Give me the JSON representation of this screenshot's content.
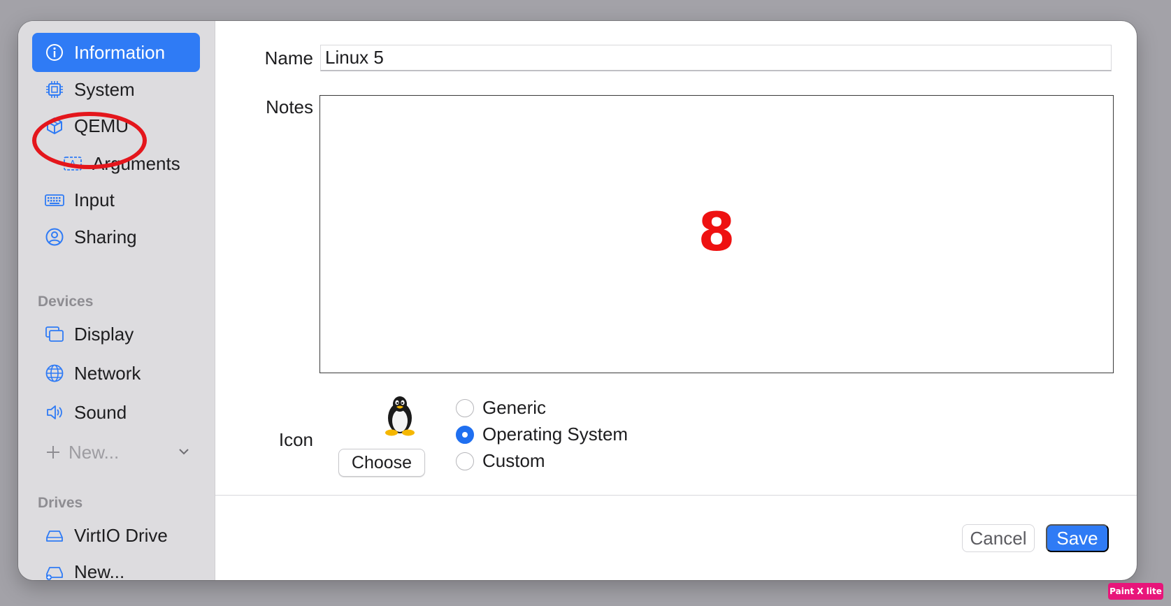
{
  "sidebar": {
    "items": [
      {
        "label": "Information",
        "icon": "info-circle-icon",
        "active": true
      },
      {
        "label": "System",
        "icon": "cpu-chip-icon"
      },
      {
        "label": "QEMU",
        "icon": "cube-icon"
      },
      {
        "label": "Arguments",
        "icon": "text-field-icon"
      },
      {
        "label": "Input",
        "icon": "keyboard-icon"
      },
      {
        "label": "Sharing",
        "icon": "person-circle-icon"
      }
    ],
    "devices_header": "Devices",
    "devices": [
      {
        "label": "Display",
        "icon": "display-windows-icon"
      },
      {
        "label": "Network",
        "icon": "globe-icon"
      },
      {
        "label": "Sound",
        "icon": "speaker-icon"
      }
    ],
    "new_device_label": "New...",
    "drives_header": "Drives",
    "drives": [
      {
        "label": "VirtIO Drive",
        "icon": "drive-icon"
      },
      {
        "label": "New...",
        "icon": "add-drive-icon"
      }
    ]
  },
  "form": {
    "name_label": "Name",
    "name_value": "Linux 5",
    "notes_label": "Notes",
    "notes_overlay_number": "8",
    "icon_label": "Icon",
    "choose_label": "Choose",
    "icon_options": [
      {
        "label": "Generic",
        "selected": false
      },
      {
        "label": "Operating System",
        "selected": true
      },
      {
        "label": "Custom",
        "selected": false
      }
    ]
  },
  "footer": {
    "cancel_label": "Cancel",
    "save_label": "Save"
  },
  "watermark": "Paint X lite",
  "colors": {
    "accent": "#2f7bf5",
    "annotation": "#e4161c",
    "sidebar_bg": "#dddcdf"
  }
}
